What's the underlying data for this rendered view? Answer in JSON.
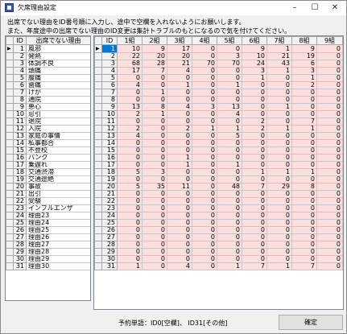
{
  "window": {
    "title": "欠席理由設定",
    "minimize": "–",
    "maximize": "☐",
    "close": "✕"
  },
  "instructions": [
    "出席でない理由をID番号順に入力し、途中で空欄を入れないようにお願いします。",
    "また、年度途中の出席でない理由のID変更は集計トラブルのもとになるので気を付けてください。"
  ],
  "reason_grid": {
    "headers": [
      "ID",
      "出席でない理由"
    ],
    "rows": [
      {
        "id": "1",
        "reason": "風邪"
      },
      {
        "id": "2",
        "reason": "発熱"
      },
      {
        "id": "3",
        "reason": "体調不良"
      },
      {
        "id": "4",
        "reason": "頭痛"
      },
      {
        "id": "5",
        "reason": "腹痛"
      },
      {
        "id": "6",
        "reason": "歯痛"
      },
      {
        "id": "7",
        "reason": "けが"
      },
      {
        "id": "8",
        "reason": "通院"
      },
      {
        "id": "9",
        "reason": "悪心"
      },
      {
        "id": "10",
        "reason": "忌引"
      },
      {
        "id": "11",
        "reason": "退院"
      },
      {
        "id": "12",
        "reason": "入院"
      },
      {
        "id": "13",
        "reason": "家庭の事情"
      },
      {
        "id": "14",
        "reason": "私事都合"
      },
      {
        "id": "15",
        "reason": "不登校"
      },
      {
        "id": "16",
        "reason": "バンク"
      },
      {
        "id": "17",
        "reason": "乗遅れ"
      },
      {
        "id": "18",
        "reason": "交通渋滞"
      },
      {
        "id": "19",
        "reason": "交通途絶"
      },
      {
        "id": "20",
        "reason": "事故"
      },
      {
        "id": "21",
        "reason": "出引"
      },
      {
        "id": "22",
        "reason": "受験"
      },
      {
        "id": "23",
        "reason": "インフルエンザ"
      },
      {
        "id": "24",
        "reason": "理由23"
      },
      {
        "id": "25",
        "reason": "理由24"
      },
      {
        "id": "26",
        "reason": "理由25"
      },
      {
        "id": "27",
        "reason": "理由26"
      },
      {
        "id": "28",
        "reason": "理由27"
      },
      {
        "id": "29",
        "reason": "理由28"
      },
      {
        "id": "30",
        "reason": "理由29"
      },
      {
        "id": "31",
        "reason": "理由30"
      }
    ]
  },
  "count_grid": {
    "headers": [
      "ID",
      "1組",
      "2組",
      "3組",
      "4組",
      "5組",
      "6組",
      "7組",
      "8組",
      "9組"
    ],
    "rows": [
      {
        "id": "1",
        "v": [
          "10",
          "9",
          "17",
          "0",
          "0",
          "9",
          "1",
          "9",
          "0"
        ]
      },
      {
        "id": "2",
        "v": [
          "22",
          "20",
          "20",
          "0",
          "3",
          "10",
          "21",
          "19",
          "0"
        ]
      },
      {
        "id": "3",
        "v": [
          "68",
          "28",
          "21",
          "70",
          "70",
          "24",
          "43",
          "6",
          "0"
        ]
      },
      {
        "id": "4",
        "v": [
          "17",
          "7",
          "4",
          "0",
          "0",
          "3",
          "1",
          "3",
          "0"
        ]
      },
      {
        "id": "5",
        "v": [
          "0",
          "0",
          "0",
          "0",
          "0",
          "1",
          "0",
          "1",
          "0"
        ]
      },
      {
        "id": "6",
        "v": [
          "4",
          "0",
          "1",
          "0",
          "1",
          "0",
          "0",
          "2",
          "0"
        ]
      },
      {
        "id": "7",
        "v": [
          "0",
          "1",
          "0",
          "0",
          "0",
          "0",
          "0",
          "0",
          "0"
        ]
      },
      {
        "id": "8",
        "v": [
          "0",
          "0",
          "0",
          "0",
          "0",
          "0",
          "0",
          "0",
          "0"
        ]
      },
      {
        "id": "9",
        "v": [
          "13",
          "8",
          "4",
          "3",
          "13",
          "0",
          "1",
          "0",
          "0"
        ]
      },
      {
        "id": "10",
        "v": [
          "2",
          "1",
          "0",
          "0",
          "4",
          "0",
          "0",
          "0",
          "0"
        ]
      },
      {
        "id": "11",
        "v": [
          "0",
          "0",
          "0",
          "0",
          "0",
          "2",
          "0",
          "7",
          "0"
        ]
      },
      {
        "id": "12",
        "v": [
          "2",
          "0",
          "2",
          "1",
          "1",
          "2",
          "1",
          "1",
          "0"
        ]
      },
      {
        "id": "13",
        "v": [
          "4",
          "0",
          "0",
          "0",
          "5",
          "0",
          "0",
          "0",
          "0"
        ]
      },
      {
        "id": "14",
        "v": [
          "0",
          "0",
          "0",
          "0",
          "0",
          "0",
          "0",
          "0",
          "0"
        ]
      },
      {
        "id": "15",
        "v": [
          "0",
          "0",
          "0",
          "0",
          "0",
          "0",
          "0",
          "0",
          "0"
        ]
      },
      {
        "id": "16",
        "v": [
          "0",
          "0",
          "1",
          "0",
          "0",
          "0",
          "0",
          "0",
          "0"
        ]
      },
      {
        "id": "17",
        "v": [
          "0",
          "0",
          "1",
          "0",
          "1",
          "0",
          "0",
          "0",
          "0"
        ]
      },
      {
        "id": "18",
        "v": [
          "5",
          "3",
          "0",
          "0",
          "0",
          "1",
          "1",
          "1",
          "0"
        ]
      },
      {
        "id": "19",
        "v": [
          "0",
          "0",
          "0",
          "0",
          "0",
          "0",
          "0",
          "0",
          "0"
        ]
      },
      {
        "id": "20",
        "v": [
          "5",
          "35",
          "11",
          "0",
          "48",
          "7",
          "29",
          "8",
          "0"
        ]
      },
      {
        "id": "21",
        "v": [
          "0",
          "0",
          "0",
          "0",
          "0",
          "0",
          "0",
          "0",
          "0"
        ]
      },
      {
        "id": "22",
        "v": [
          "0",
          "0",
          "0",
          "0",
          "0",
          "0",
          "0",
          "0",
          "0"
        ]
      },
      {
        "id": "23",
        "v": [
          "0",
          "0",
          "0",
          "0",
          "0",
          "0",
          "0",
          "0",
          "0"
        ]
      },
      {
        "id": "24",
        "v": [
          "0",
          "0",
          "0",
          "0",
          "0",
          "0",
          "0",
          "0",
          "0"
        ]
      },
      {
        "id": "25",
        "v": [
          "0",
          "0",
          "0",
          "0",
          "0",
          "0",
          "0",
          "0",
          "0"
        ]
      },
      {
        "id": "26",
        "v": [
          "0",
          "0",
          "0",
          "0",
          "0",
          "0",
          "0",
          "0",
          "0"
        ]
      },
      {
        "id": "27",
        "v": [
          "0",
          "0",
          "0",
          "0",
          "0",
          "0",
          "0",
          "0",
          "0"
        ]
      },
      {
        "id": "28",
        "v": [
          "0",
          "0",
          "0",
          "0",
          "0",
          "0",
          "0",
          "0",
          "0"
        ]
      },
      {
        "id": "29",
        "v": [
          "0",
          "0",
          "0",
          "0",
          "0",
          "0",
          "0",
          "0",
          "0"
        ]
      },
      {
        "id": "30",
        "v": [
          "0",
          "0",
          "0",
          "0",
          "0",
          "0",
          "0",
          "0",
          "0"
        ]
      },
      {
        "id": "31",
        "v": [
          "1",
          "0",
          "4",
          "0",
          "1",
          "7",
          "1",
          "7",
          "0"
        ]
      }
    ]
  },
  "footer": {
    "note": "予約単語：ID0[空欄]、 ID31[その他]",
    "ok_label": "確定"
  },
  "colors": {
    "count_cell_bg": "#ffdede",
    "selection": "#0078d7"
  }
}
